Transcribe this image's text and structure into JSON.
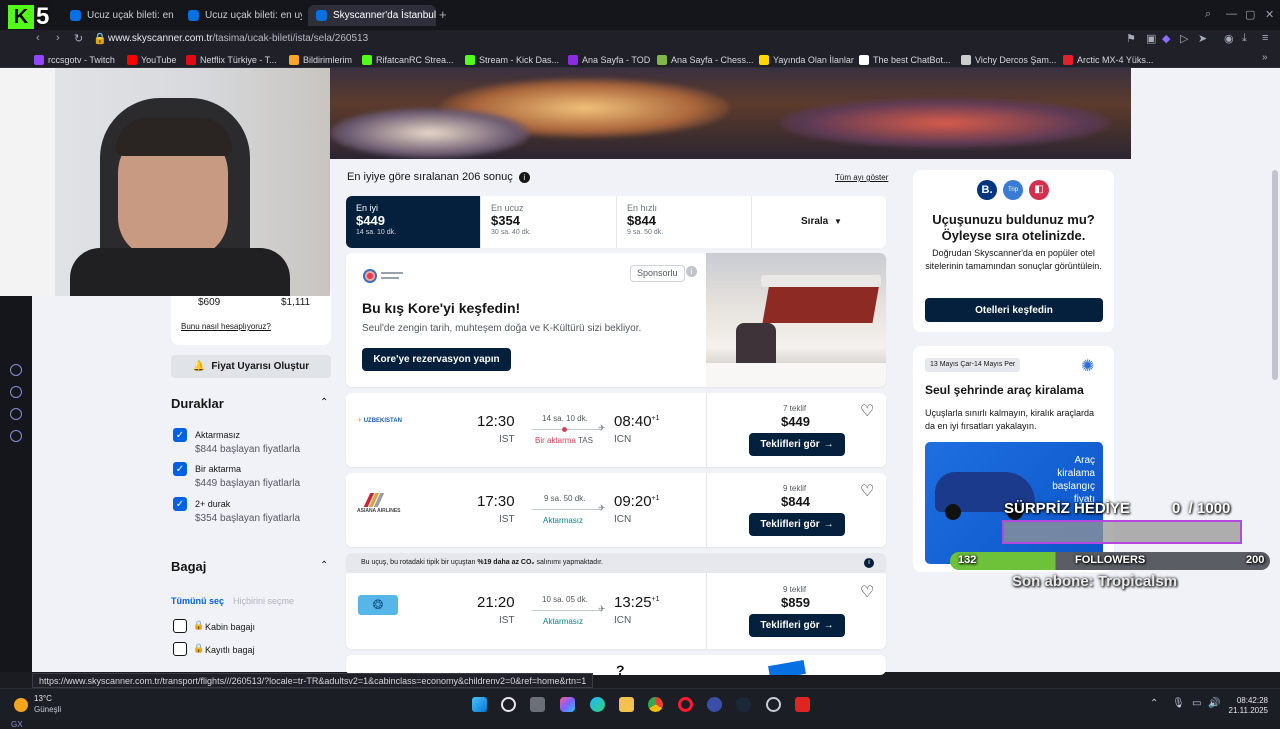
{
  "browser": {
    "tabs": [
      {
        "label": "Ucuz uçak bileti: en uygu"
      },
      {
        "label": "Ucuz uçak bileti: en uygu"
      },
      {
        "label": "Skyscanner'da İstanbul-S"
      }
    ],
    "url_host": "www.skyscanner.com.tr",
    "url_path": "/tasima/ucak-bileti/ista/sela/260513",
    "status_url": "https://www.skyscanner.com.tr/transport/flights///260513/?locale=tr-TR&adultsv2=1&cabinclass=economy&childrenv2=0&ref=home&rtn=1",
    "bookmarks": [
      {
        "label": "rccsgotv - Twitch",
        "color": "#9146ff"
      },
      {
        "label": "YouTube",
        "color": "#ff0000"
      },
      {
        "label": "Netflix Türkiye - T...",
        "color": "#e50914"
      },
      {
        "label": "Bildirimlerim",
        "color": "#f5a623"
      },
      {
        "label": "RifatcanRC Strea...",
        "color": "#53fc18"
      },
      {
        "label": "Stream - Kick Das...",
        "color": "#53fc18"
      },
      {
        "label": "Ana Sayfa - TOD",
        "color": "#8b2be2"
      },
      {
        "label": "Ana Sayfa - Chess...",
        "color": "#81b64c"
      },
      {
        "label": "Yayında Olan İlanlar",
        "color": "#ffd800"
      },
      {
        "label": "The best ChatBot...",
        "color": "#ffffff"
      },
      {
        "label": "Vichy Dercos Şam...",
        "color": "#cccccc"
      },
      {
        "label": "Arctic MX-4 Yüks...",
        "color": "#e5202a"
      }
    ]
  },
  "stream_overlay": {
    "logo_k": "K",
    "logo_num": "5",
    "gift_label": "SÜRPRİZ HEDİYE",
    "gift_progress": "0  / 1000",
    "gift_fraction": 0.0,
    "followers_current": "132",
    "followers_label": "FOLLOWERS",
    "followers_goal": "200",
    "last_sub": "Son abone: Tropicalsm"
  },
  "left_panel": {
    "price_low": "$609",
    "price_high": "$1,111",
    "how_calc": "Bunu nasıl hesaplıyoruz?",
    "alert_button": "Fiyat Uyarısı Oluştur",
    "stops_title": "Duraklar",
    "stops": [
      {
        "label": "Aktarmasız",
        "sub": "$844 başlayan fiyatlarla",
        "checked": true
      },
      {
        "label": "Bir aktarma",
        "sub": "$449 başlayan fiyatlarla",
        "checked": true
      },
      {
        "label": "2+ durak",
        "sub": "$354 başlayan fiyatlarla",
        "checked": true
      }
    ],
    "baggage_title": "Bagaj",
    "select_all": "Tümünü seç",
    "select_none": "Hiçbirini seçme",
    "baggage": [
      {
        "label": "Kabin bagajı"
      },
      {
        "label": "Kayıtlı bagaj"
      }
    ]
  },
  "results": {
    "summary": "En iyiye göre sıralanan 206 sonuç",
    "show_all": "Tüm ayı göster",
    "tabs": [
      {
        "label": "En iyi",
        "price": "$449",
        "duration": "14 sa. 10 dk."
      },
      {
        "label": "En ucuz",
        "price": "$354",
        "duration": "30 sa. 40 dk."
      },
      {
        "label": "En hızlı",
        "price": "$844",
        "duration": "9 sa. 50 dk."
      }
    ],
    "sort_label": "Sırala",
    "ad": {
      "sponsored": "Sponsorlu",
      "title": "Bu kış Kore'yi keşfedin!",
      "text": "Seul'de zengin tarih, muhteşem doğa ve K-Kültürü sizi bekliyor.",
      "button": "Kore'ye rezervasyon yapın"
    },
    "flights": [
      {
        "airline": "UZBEKISTAN",
        "depart": "12:30",
        "from": "IST",
        "duration": "14 sa. 10 dk.",
        "stops": "Bir aktarma",
        "via": "TAS",
        "arrive": "08:40",
        "day": "+1",
        "to": "ICN",
        "offers": "7 teklif",
        "price": "$449",
        "button": "Teklifleri gör"
      },
      {
        "airline": "ASIANA AIRLINES",
        "depart": "17:30",
        "from": "IST",
        "duration": "9 sa. 50 dk.",
        "stops": "Aktarmasız",
        "via": "",
        "arrive": "09:20",
        "day": "+1",
        "to": "ICN",
        "offers": "9 teklif",
        "price": "$844",
        "button": "Teklifleri gör"
      },
      {
        "airline": "",
        "depart": "21:20",
        "from": "IST",
        "duration": "10 sa. 05 dk.",
        "stops": "Aktarmasız",
        "via": "",
        "arrive": "13:25",
        "day": "+1",
        "to": "ICN",
        "offers": "9 teklif",
        "price": "$859",
        "button": "Teklifleri gör"
      }
    ],
    "eco_pre": "Bu uçuş, bu rotadaki tipik bir uçuştan ",
    "eco_bold": "%19 daha az CO₂",
    "eco_post": " salınımı yapmaktadır."
  },
  "right_panel": {
    "hotel_title": "Uçuşunuzu buldunuz mu? Öyleyse sıra otelinizde.",
    "hotel_text": "Doğrudan Skyscanner'da en popüler otel sitelerinin tamamından sonuçlar görüntülein.",
    "hotel_button": "Otelleri keşfedin",
    "car_dates": "13 Mayıs Çar-14 Mayıs Per",
    "car_title": "Seul şehrinde araç kiralama",
    "car_text": "Uçuşlarla sınırlı kalmayın, kiralık araçlarda da en iyi fırsatları yakalayın.",
    "car_promo": "Araç kiralama başlangıç fiyatı"
  },
  "taskbar": {
    "weather_temp": "13°C",
    "weather_desc": "Güneşli",
    "time": "08:42:28",
    "date": "21.11.2025"
  }
}
